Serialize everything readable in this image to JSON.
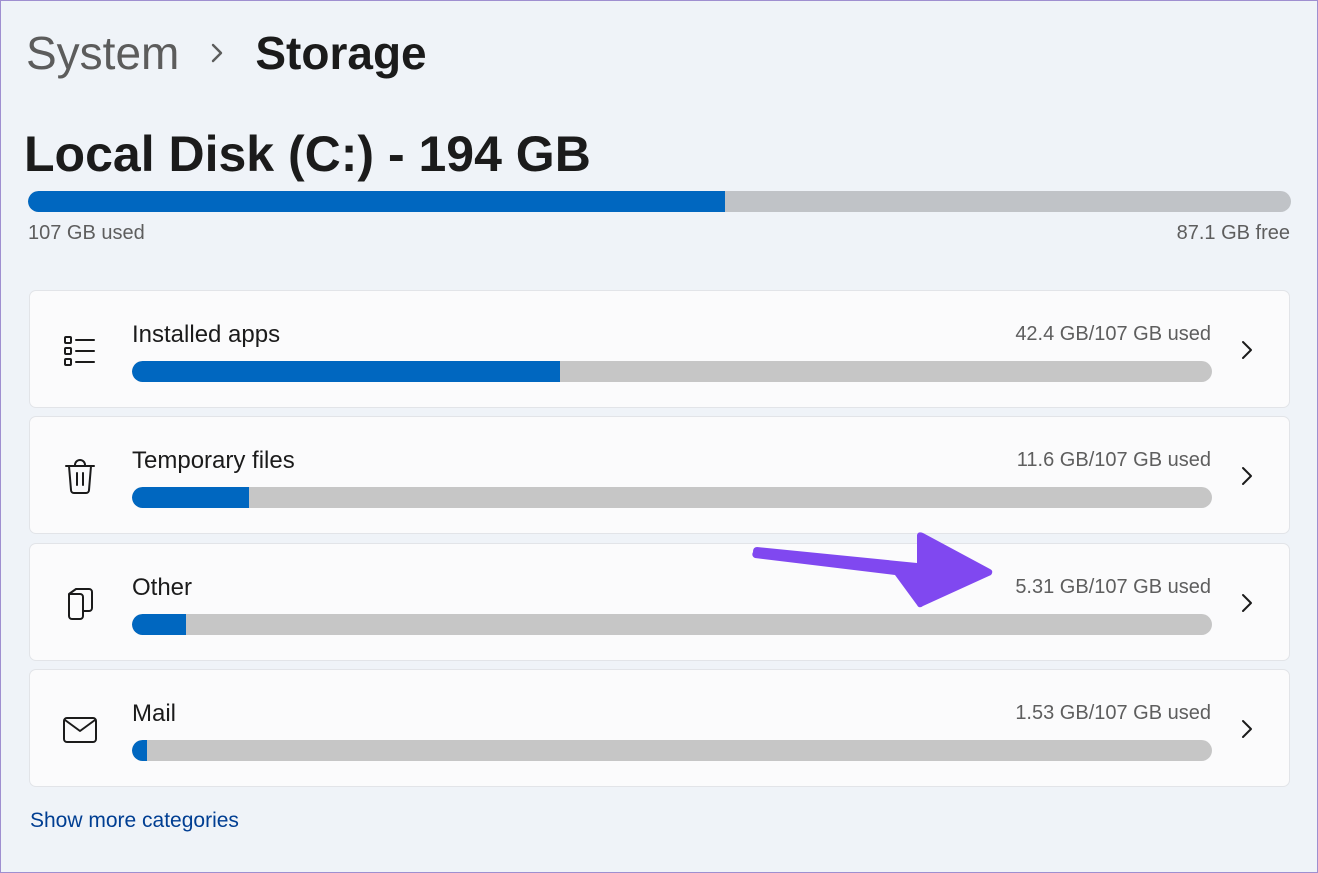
{
  "breadcrumb": {
    "parent": "System",
    "current": "Storage"
  },
  "disk": {
    "title": "Local Disk (C:) - 194 GB",
    "used_label": "107 GB used",
    "free_label": "87.1 GB free",
    "used_fraction": 0.552
  },
  "categories": [
    {
      "label": "Installed apps",
      "amount": "42.4 GB/107 GB used",
      "icon": "list-icon",
      "fraction": 0.396
    },
    {
      "label": "Temporary files",
      "amount": "11.6 GB/107 GB used",
      "icon": "trash-icon",
      "fraction": 0.108
    },
    {
      "label": "Other",
      "amount": "5.31 GB/107 GB used",
      "icon": "document-icon",
      "fraction": 0.05
    },
    {
      "label": "Mail",
      "amount": "1.53 GB/107 GB used",
      "icon": "mail-icon",
      "fraction": 0.014
    }
  ],
  "show_more": "Show more categories",
  "colors": {
    "accent": "#0067c0",
    "annotation_arrow": "#8048f0",
    "link": "#003e92"
  }
}
